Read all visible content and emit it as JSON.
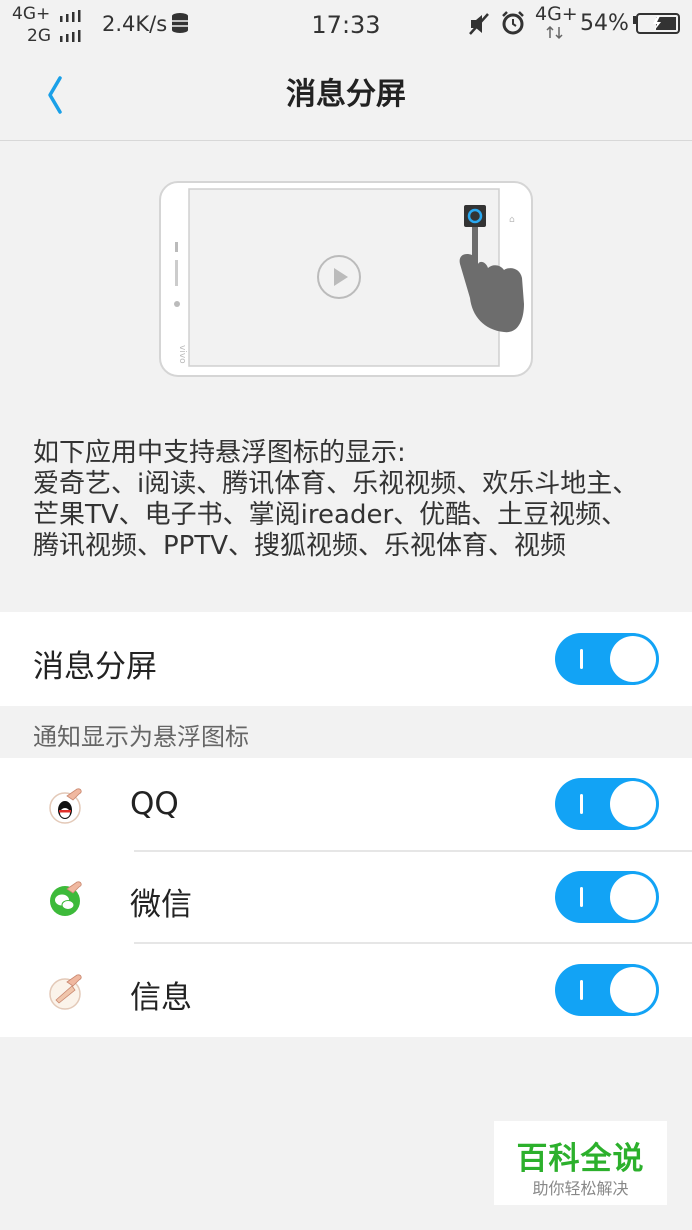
{
  "status_bar": {
    "net_top": "4G+",
    "net_bottom": "2G",
    "speed": "2.4K/s",
    "time": "17:33",
    "net_right": "4G+",
    "battery": "54%"
  },
  "header": {
    "title": "消息分屏"
  },
  "description": {
    "line1": "如下应用中支持悬浮图标的显示:",
    "line2": "爱奇艺、i阅读、腾讯体育、乐视视频、欢乐斗地主、",
    "line3": "芒果TV、电子书、掌阅ireader、优酷、土豆视频、",
    "line4": "腾讯视频、PPTV、搜狐视频、乐视体育、视频"
  },
  "main_toggle": {
    "label": "消息分屏",
    "on": true
  },
  "section": {
    "label": "通知显示为悬浮图标"
  },
  "apps": [
    {
      "label": "QQ",
      "icon": "qq-icon",
      "on": true
    },
    {
      "label": "微信",
      "icon": "wechat-icon",
      "on": true
    },
    {
      "label": "信息",
      "icon": "message-icon",
      "on": true
    }
  ],
  "watermark": {
    "title": "百科全说",
    "subtitle": "助你轻松解决"
  },
  "colors": {
    "accent": "#12a3f5",
    "background": "#f2f2f2",
    "watermark_green": "#2cb02c"
  }
}
